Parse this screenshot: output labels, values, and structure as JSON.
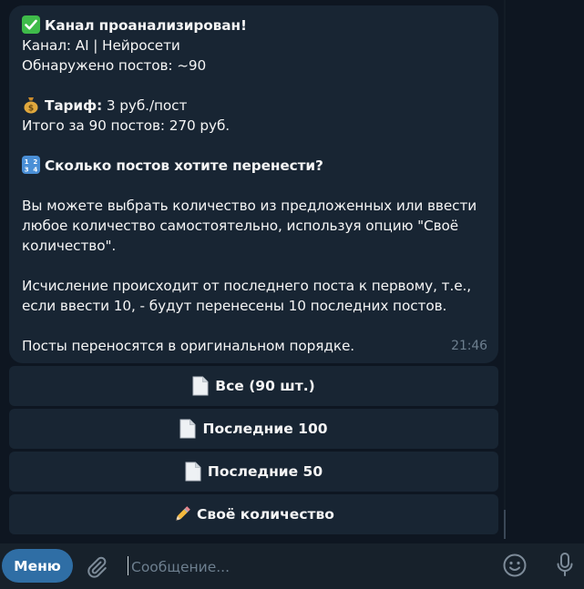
{
  "message": {
    "title": "Канал проанализирован!",
    "channel_line": "Канал: AI | Нейросети",
    "posts_found_line": "Обнаружено постов: ~90",
    "tariff_label": "Тариф:",
    "tariff_value": " 3 руб./пост",
    "total_line": "Итого за 90 постов: 270 руб.",
    "question": "Сколько постов хотите перенести?",
    "info_paragraph_lines": [
      "Вы можете выбрать количество из предложенных или ввести",
      "любое количество самостоятельно, используя опцию \"Своё",
      "количество\"."
    ],
    "counting_paragraph_lines": [
      "Исчисление происходит от последнего поста к первому, т.е.,",
      "если ввести 10, - будут перенесены 10 последних постов."
    ],
    "order_line": "Посты переносятся в оригинальном порядке.",
    "time": "21:46",
    "icons": [
      "check-mark-icon",
      "money-bag-icon",
      "numbers-icon"
    ]
  },
  "keyboard": {
    "buttons": [
      {
        "label": "Все (90 шт.)",
        "icon": "document-icon"
      },
      {
        "label": "Последние 100",
        "icon": "document-icon"
      },
      {
        "label": "Последние 50",
        "icon": "document-icon"
      },
      {
        "label": "Своё количество",
        "icon": "pencil-icon"
      }
    ]
  },
  "composer": {
    "menu_label": "Меню",
    "placeholder": "Сообщение...",
    "value": "",
    "icons": [
      "paperclip-icon",
      "emoji-icon",
      "microphone-icon"
    ]
  },
  "colors": {
    "background": "#0e1621",
    "bubble": "#182533",
    "composer": "#17212b",
    "menu_button": "#2f6ea5",
    "muted_text": "#6d7f8f",
    "check": "#3fbb4a"
  }
}
